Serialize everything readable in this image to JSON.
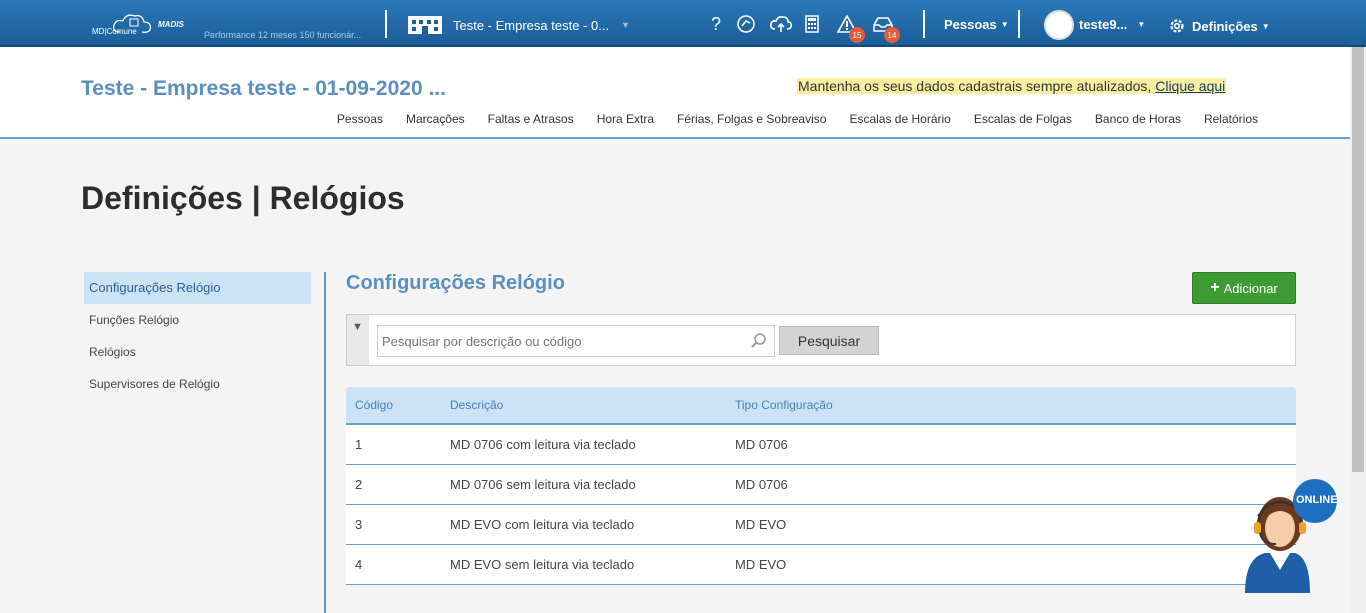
{
  "topbar": {
    "logo_text": "MD|Comune",
    "logo_brand": "MADIS",
    "performance_text": "Performance 12 meses 150 funcionár...",
    "company_selector": "Teste - Empresa teste - 0...",
    "alerts_badge": "15",
    "inbox_badge": "14",
    "people_menu": "Pessoas",
    "user_name": "teste9...",
    "settings_menu": "Definições"
  },
  "header": {
    "company_title": "Teste - Empresa teste - 01-09-2020 ...",
    "notice_text": "Mantenha os seus dados cadastrais sempre atualizados,",
    "notice_link": "Clique aqui",
    "nav": [
      "Pessoas",
      "Marcações",
      "Faltas e Atrasos",
      "Hora Extra",
      "Férias, Folgas e Sobreaviso",
      "Escalas de Horário",
      "Escalas de Folgas",
      "Banco de Horas",
      "Relatórios"
    ]
  },
  "page_title": "Definições | Relógios",
  "sidebar": {
    "items": [
      "Configurações Relógio",
      "Funções Relógio",
      "Relógios",
      "Supervisores de Relógio"
    ]
  },
  "main": {
    "section_title": "Configurações Relógio",
    "add_button": "Adicionar",
    "search_placeholder": "Pesquisar por descrição ou código",
    "search_button": "Pesquisar",
    "columns": [
      "Código",
      "Descrição",
      "Tipo Configuração"
    ],
    "rows": [
      [
        "1",
        "MD 0706 com leitura via teclado",
        "MD 0706"
      ],
      [
        "2",
        "MD 0706 sem leitura via teclado",
        "MD 0706"
      ],
      [
        "3",
        "MD EVO com leitura via teclado",
        "MD EVO"
      ],
      [
        "4",
        "MD EVO sem leitura via teclado",
        "MD EVO"
      ]
    ]
  },
  "chat_status": "ONLINE"
}
